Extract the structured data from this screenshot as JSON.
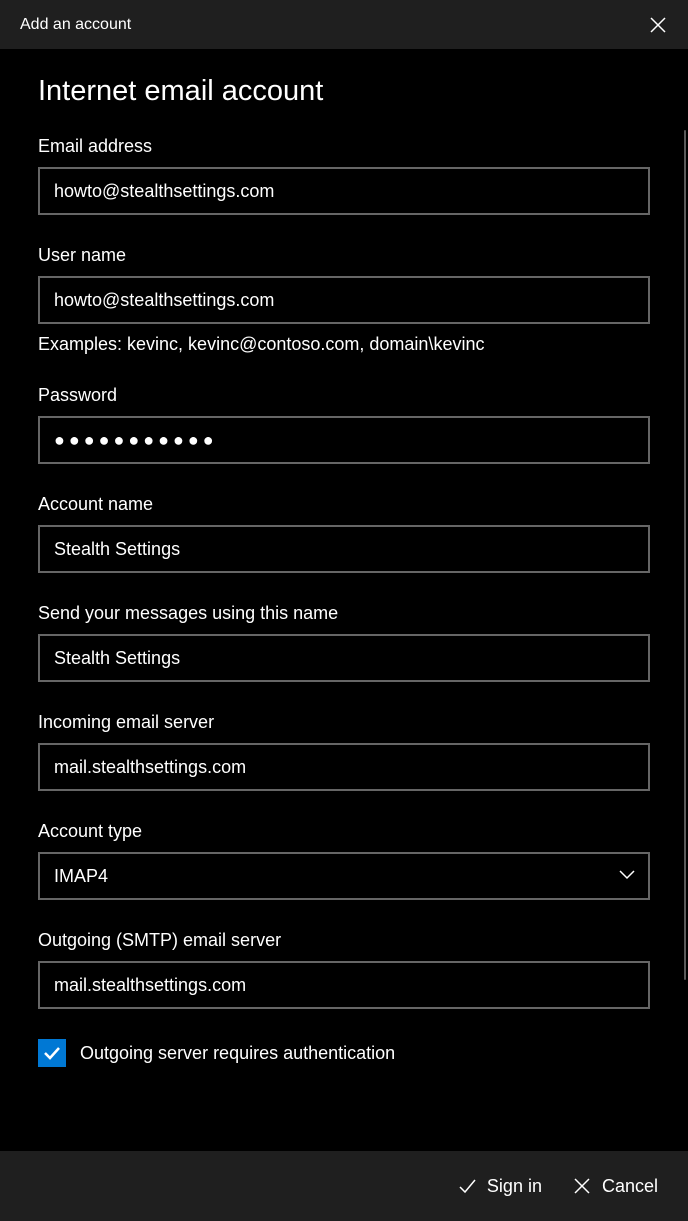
{
  "titlebar": {
    "title": "Add an account"
  },
  "heading": "Internet email account",
  "fields": {
    "email": {
      "label": "Email address",
      "value": "howto@stealthsettings.com"
    },
    "username": {
      "label": "User name",
      "value": "howto@stealthsettings.com",
      "hint": "Examples: kevinc, kevinc@contoso.com, domain\\kevinc"
    },
    "password": {
      "label": "Password",
      "value": "●●●●●●●●●●●"
    },
    "account_name": {
      "label": "Account name",
      "value": "Stealth Settings"
    },
    "send_name": {
      "label": "Send your messages using this name",
      "value": "Stealth Settings"
    },
    "incoming_server": {
      "label": "Incoming email server",
      "value": "mail.stealthsettings.com"
    },
    "account_type": {
      "label": "Account type",
      "value": "IMAP4"
    },
    "outgoing_server": {
      "label": "Outgoing (SMTP) email server",
      "value": "mail.stealthsettings.com"
    }
  },
  "checkbox": {
    "outgoing_auth": {
      "label": "Outgoing server requires authentication",
      "checked": true
    }
  },
  "footer": {
    "signin": "Sign in",
    "cancel": "Cancel"
  }
}
